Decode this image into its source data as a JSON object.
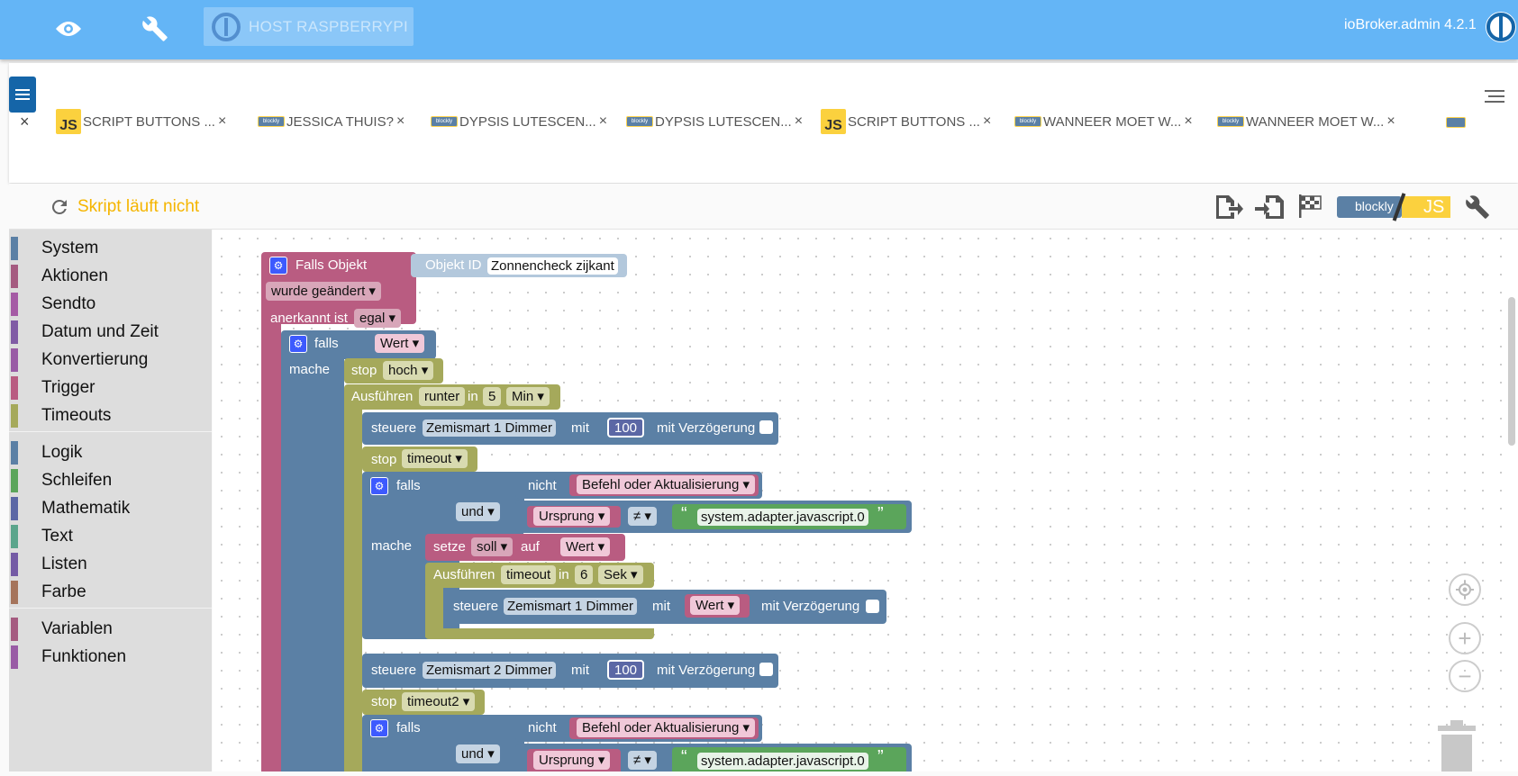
{
  "header": {
    "host_label": "HOST RASPBERRYPI",
    "version": "ioBroker.admin 4.2.1"
  },
  "tabs": [
    {
      "label": "SCRIPT BUTTONS ...",
      "type": "JS"
    },
    {
      "label": "JESSICA THUIS?",
      "type": "blockly"
    },
    {
      "label": "DYPSIS LUTESCEN...",
      "type": "blockly"
    },
    {
      "label": "DYPSIS LUTESCEN...",
      "type": "blockly"
    },
    {
      "label": "SCRIPT BUTTONS ...",
      "type": "JS"
    },
    {
      "label": "WANNEER MOET W...",
      "type": "blockly"
    },
    {
      "label": "WANNEER MOET W...",
      "type": "blockly"
    }
  ],
  "tab_close": "×",
  "badge_js": "JS",
  "badge_blockly": "blockly",
  "toolbar": {
    "status": "Skript läuft nicht",
    "mode_blockly": "blockly",
    "mode_js": "JS"
  },
  "sidebar": {
    "group1": [
      {
        "label": "System",
        "color": "#5b80a5"
      },
      {
        "label": "Aktionen",
        "color": "#a55b80"
      },
      {
        "label": "Sendto",
        "color": "#a55ba5"
      },
      {
        "label": "Datum und Zeit",
        "color": "#805ba5"
      },
      {
        "label": "Konvertierung",
        "color": "#995ba5"
      },
      {
        "label": "Trigger",
        "color": "#b95c81"
      },
      {
        "label": "Timeouts",
        "color": "#a5a95b"
      }
    ],
    "group2": [
      {
        "label": "Logik",
        "color": "#5b80a5"
      },
      {
        "label": "Schleifen",
        "color": "#5ba55b"
      },
      {
        "label": "Mathematik",
        "color": "#5b67a5"
      },
      {
        "label": "Text",
        "color": "#5ba58c"
      },
      {
        "label": "Listen",
        "color": "#745ba5"
      },
      {
        "label": "Farbe",
        "color": "#a5745b"
      }
    ],
    "group3": [
      {
        "label": "Variablen",
        "color": "#a55b80"
      },
      {
        "label": "Funktionen",
        "color": "#995ba5"
      }
    ]
  },
  "blocks": {
    "trigger_title": "Falls Objekt",
    "object_id_label": "Objekt ID",
    "object_id_value": "Zonnencheck zijkant",
    "changed": "wurde geändert",
    "ack_label": "anerkannt ist",
    "ack_value": "egal",
    "if": "falls",
    "do": "mache",
    "value": "Wert",
    "stop": "stop",
    "timer_hoch": "hoch",
    "run": "Ausführen",
    "timer_runter": "runter",
    "in": "in",
    "delay1": "5",
    "unit1": "Min",
    "control": "steuere",
    "device1": "Zemismart 1  Dimmer",
    "device2": "Zemismart 2  Dimmer",
    "with": "mit",
    "value100": "100",
    "with_delay": "mit Verzögerung",
    "timer_timeout": "timeout",
    "timer_timeout2": "timeout2",
    "not": "nicht",
    "cmd_or_update": "Befehl oder Aktualisierung",
    "and": "und",
    "origin": "Ursprung",
    "neq": "≠",
    "adapter": "system.adapter.javascript.0",
    "quote_open": "“",
    "quote_close": "”",
    "set": "setze",
    "var_soll": "soll",
    "on": "auf",
    "delay2": "6",
    "unit2": "Sek"
  }
}
